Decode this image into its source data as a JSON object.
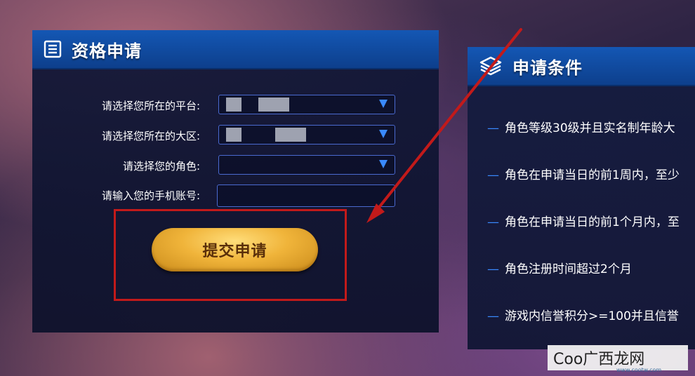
{
  "left_panel": {
    "title": "资格申请",
    "icon": "document-list-icon",
    "fields": [
      {
        "label": "请选择您所在的平台:",
        "type": "select"
      },
      {
        "label": "请选择您所在的大区:",
        "type": "select"
      },
      {
        "label": "请选择您的角色:",
        "type": "select"
      },
      {
        "label": "请输入您的手机账号:",
        "type": "input"
      }
    ],
    "submit_label": "提交申请"
  },
  "right_panel": {
    "title": "申请条件",
    "icon": "layers-icon",
    "conditions": [
      "角色等级30级并且实名制年龄大",
      "角色在申请当日的前1周内，至少",
      "角色在申请当日的前1个月内，至",
      "角色注册时间超过2个月",
      "游戏内信誉积分>=100并且信誉"
    ],
    "dash": "—"
  },
  "watermark": {
    "text": "Coo广西龙网",
    "sub": "www.cootw.com"
  },
  "colors": {
    "header_blue": "#1457b4",
    "accent_blue": "#3a8aff",
    "button_gold": "#f0b43a",
    "annotation_red": "#c21a1a"
  }
}
